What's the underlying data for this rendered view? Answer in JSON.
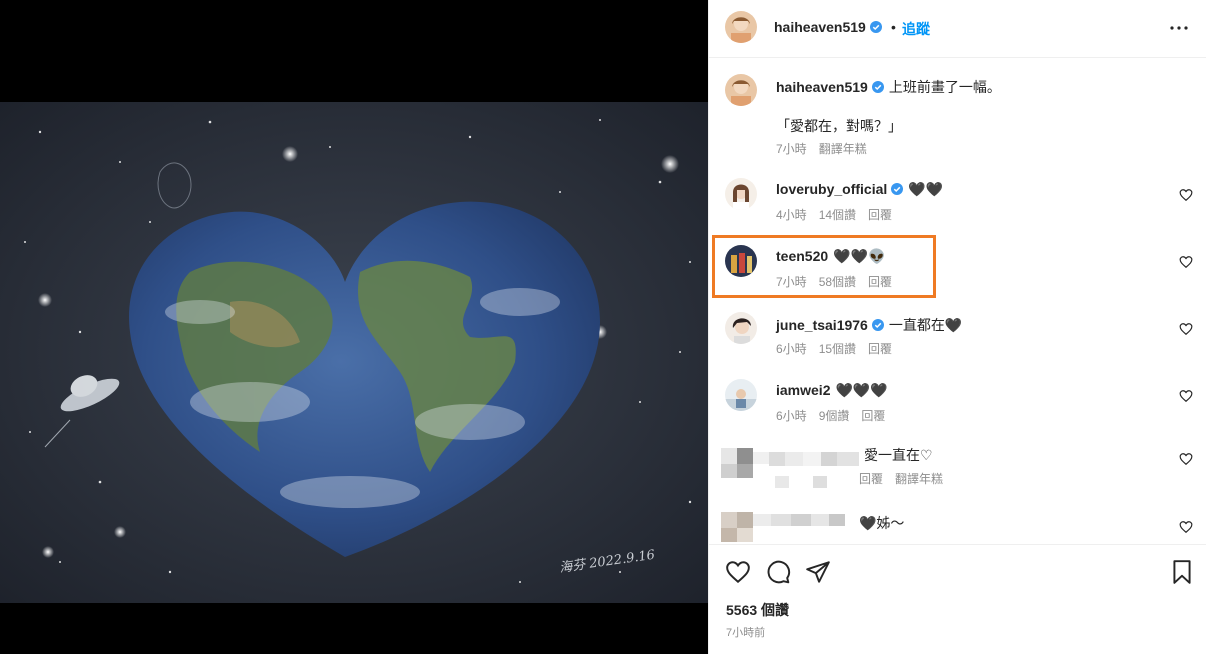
{
  "post": {
    "author": "haiheaven519",
    "follow_label": "追蹤",
    "caption_text": "上班前畫了一幅。",
    "caption_quote": "「愛都在，對嗎？」",
    "caption_time": "7小時",
    "caption_translate": "翻譯年糕",
    "likes": "5563 個讚",
    "posted_time": "7小時前",
    "signature": "海芬 2022.9.16"
  },
  "comments": [
    {
      "user": "loveruby_official",
      "verified": true,
      "text": "🖤🖤",
      "time": "4小時",
      "likes": "14個讚",
      "reply": "回覆"
    },
    {
      "user": "teen520",
      "verified": false,
      "text": "🖤🖤👽",
      "time": "7小時",
      "likes": "58個讚",
      "reply": "回覆"
    },
    {
      "user": "june_tsai1976",
      "verified": true,
      "text": "一直都在🖤",
      "time": "6小時",
      "likes": "15個讚",
      "reply": "回覆"
    },
    {
      "user": "iamwei2",
      "verified": false,
      "text": "🖤🖤🖤",
      "time": "6小時",
      "likes": "9個讚",
      "reply": "回覆"
    },
    {
      "user": "",
      "verified": false,
      "text": "愛一直在♡",
      "time": "",
      "likes": "",
      "reply": "回覆",
      "translate": "翻譯年糕"
    },
    {
      "user": "",
      "verified": false,
      "text": "🖤姊～",
      "time": "",
      "likes": "",
      "reply": ""
    }
  ],
  "colors": {
    "accent": "#0095f6",
    "highlight": "#ef7a23",
    "verified": "#3897f0"
  }
}
